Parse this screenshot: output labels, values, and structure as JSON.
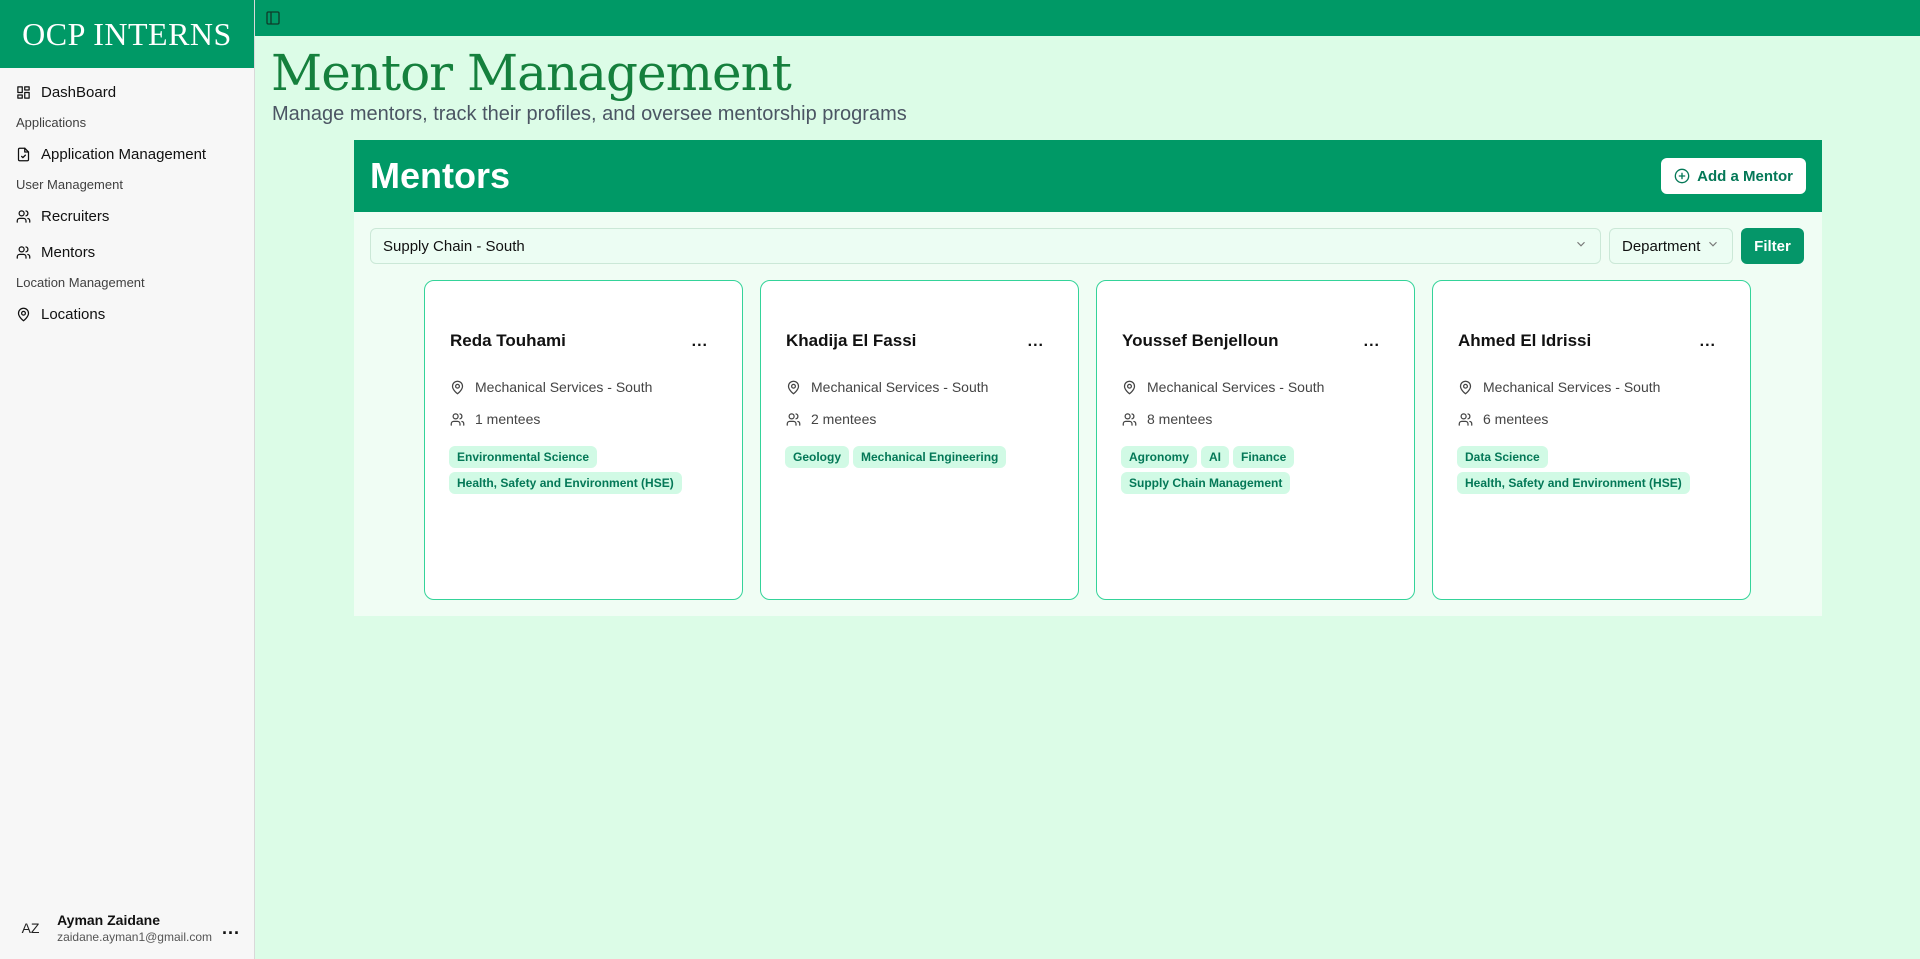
{
  "sidebar": {
    "brand": "OCP INTERNS",
    "dashboard": "DashBoard",
    "group_applications": "Applications",
    "application_management": "Application Management",
    "group_user_management": "User Management",
    "recruiters": "Recruiters",
    "mentors": "Mentors",
    "group_location_management": "Location Management",
    "locations": "Locations",
    "user": {
      "initials": "AZ",
      "name": "Ayman Zaidane",
      "email": "zaidane.ayman1@gmail.com",
      "more": "..."
    }
  },
  "header": {
    "title": "Mentor Management",
    "subtitle": "Manage mentors, track their profiles, and oversee mentorship programs"
  },
  "panel": {
    "title": "Mentors",
    "add_button": "Add a Mentor",
    "filter_value": "Supply Chain - South",
    "department_select": "Department",
    "filter_button": "Filter"
  },
  "mentors": [
    {
      "name": "Reda Touhami",
      "location": "Mechanical Services - South",
      "mentees": "1 mentees",
      "tags": [
        "Environmental Science",
        "Health, Safety and Environment (HSE)"
      ]
    },
    {
      "name": "Khadija El Fassi",
      "location": "Mechanical Services - South",
      "mentees": "2 mentees",
      "tags": [
        "Geology",
        "Mechanical Engineering"
      ]
    },
    {
      "name": "Youssef Benjelloun",
      "location": "Mechanical Services - South",
      "mentees": "8 mentees",
      "tags": [
        "Agronomy",
        "AI",
        "Finance",
        "Supply Chain Management"
      ]
    },
    {
      "name": "Ahmed El Idrissi",
      "location": "Mechanical Services - South",
      "mentees": "6 mentees",
      "tags": [
        "Data Science",
        "Health, Safety and Environment (HSE)"
      ]
    }
  ],
  "card_more": "...",
  "colors": {
    "brand_green": "#009966",
    "background": "#dcfce7",
    "title_green": "#15803d",
    "tag_bg": "#d1fae5",
    "tag_text": "#047857",
    "card_border": "#34d399"
  }
}
